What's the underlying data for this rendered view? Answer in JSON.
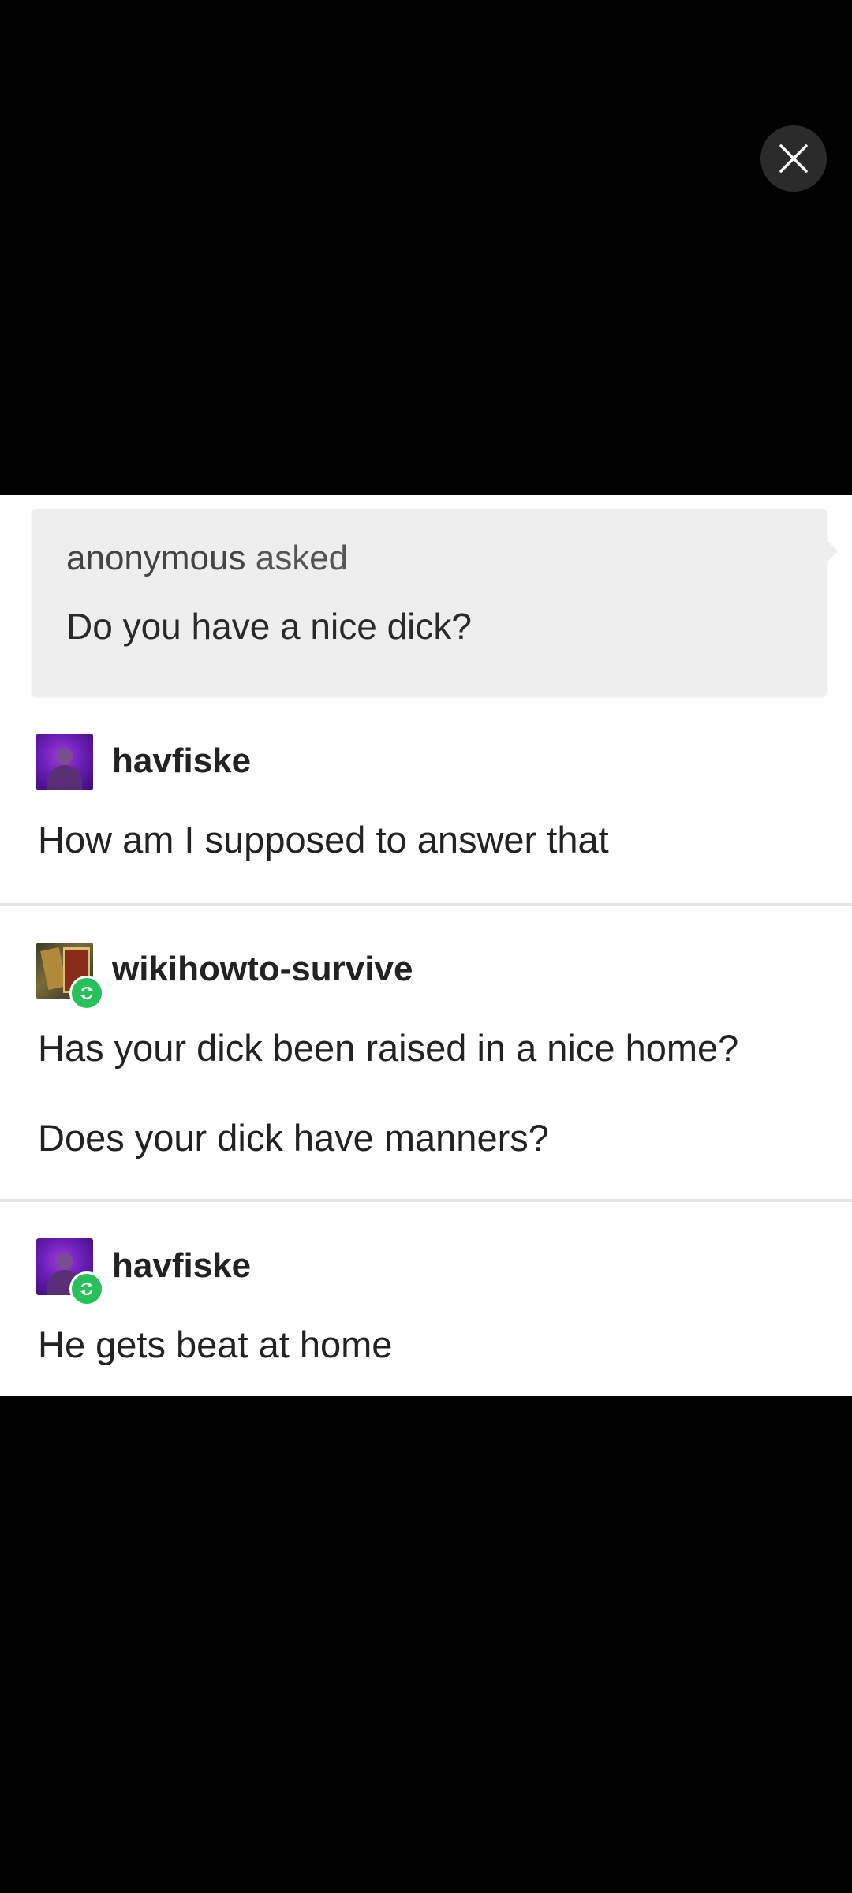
{
  "viewer": {
    "close_icon": "close-icon"
  },
  "post": {
    "ask": {
      "asker": "anonymous",
      "asked_label": "asked",
      "question": "Do you have a nice dick?"
    },
    "replies": [
      {
        "username": "havfiske",
        "avatar_icon": "avatar-purple",
        "reblog": false,
        "lines": [
          "How am I supposed to answer that"
        ]
      },
      {
        "username": "wikihowto-survive",
        "avatar_icon": "avatar-dark",
        "reblog": true,
        "lines": [
          "Has your dick been raised in a nice home?",
          "Does your dick have manners?"
        ]
      },
      {
        "username": "havfiske",
        "avatar_icon": "avatar-purple",
        "reblog": true,
        "lines": [
          "He gets beat at home"
        ]
      }
    ]
  },
  "colors": {
    "background": "#000000",
    "card": "#ffffff",
    "ask_box": "#eeeeee",
    "reblog_badge": "#28c05a"
  }
}
